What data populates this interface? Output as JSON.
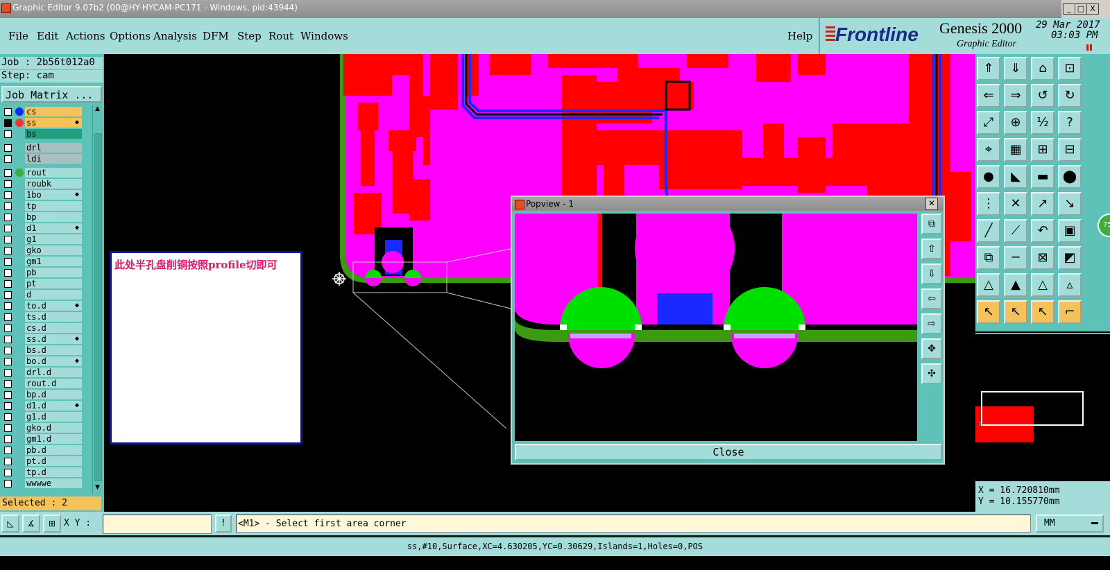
{
  "window": {
    "title": "Graphic Editor 9.07b2 (00@HY-HYCAM-PC171 - Windows, pid:43944)",
    "controls": [
      "_",
      "□",
      "X"
    ]
  },
  "menu": {
    "items": [
      "File",
      "Edit",
      "Actions",
      "Options",
      "Analysis",
      "DFM",
      "Step",
      "Rout",
      "Windows"
    ],
    "help": "Help"
  },
  "brand": {
    "logo": "Frontline",
    "product": "Genesis 2000",
    "subtitle": "Graphic Editor",
    "date": "29 Mar 2017",
    "time": "03:03 PM"
  },
  "job": {
    "job_label": "Job : 2b56t012a0",
    "step_label": "Step: cam",
    "matrix_button": "Job Matrix ..."
  },
  "layers": [
    {
      "name": "cs",
      "color": "#f5c25a",
      "dot": "#0030ff",
      "checked": false,
      "flag": ""
    },
    {
      "name": "ss",
      "color": "#f5c25a",
      "dot": "#ff3030",
      "checked": true,
      "flag": "w"
    },
    {
      "name": "bs",
      "color": "#21a080",
      "dot": "",
      "checked": false,
      "flag": ""
    },
    {
      "name": "drl",
      "color": "#a8c0c0",
      "dot": "",
      "checked": false,
      "flag": ""
    },
    {
      "name": "ldi",
      "color": "#a8c0c0",
      "dot": "",
      "checked": false,
      "flag": ""
    },
    {
      "name": "rout",
      "color": "#a3dcd8",
      "dot": "#3ab03a",
      "checked": false,
      "flag": ""
    },
    {
      "name": "roubk",
      "color": "#a3dcd8",
      "dot": "",
      "checked": false,
      "flag": ""
    },
    {
      "name": "1bo",
      "color": "#a3dcd8",
      "dot": "",
      "checked": false,
      "flag": "w"
    },
    {
      "name": "tp",
      "color": "#a3dcd8",
      "dot": "",
      "checked": false,
      "flag": ""
    },
    {
      "name": "bp",
      "color": "#a3dcd8",
      "dot": "",
      "checked": false,
      "flag": ""
    },
    {
      "name": "d1",
      "color": "#a3dcd8",
      "dot": "",
      "checked": false,
      "flag": "w"
    },
    {
      "name": "g1",
      "color": "#a3dcd8",
      "dot": "",
      "checked": false,
      "flag": ""
    },
    {
      "name": "gko",
      "color": "#a3dcd8",
      "dot": "",
      "checked": false,
      "flag": ""
    },
    {
      "name": "gm1",
      "color": "#a3dcd8",
      "dot": "",
      "checked": false,
      "flag": ""
    },
    {
      "name": "pb",
      "color": "#a3dcd8",
      "dot": "",
      "checked": false,
      "flag": ""
    },
    {
      "name": "pt",
      "color": "#a3dcd8",
      "dot": "",
      "checked": false,
      "flag": ""
    },
    {
      "name": "d",
      "color": "#a3dcd8",
      "dot": "",
      "checked": false,
      "flag": ""
    },
    {
      "name": "to.d",
      "color": "#a3dcd8",
      "dot": "",
      "checked": false,
      "flag": "w"
    },
    {
      "name": "ts.d",
      "color": "#a3dcd8",
      "dot": "",
      "checked": false,
      "flag": ""
    },
    {
      "name": "cs.d",
      "color": "#a3dcd8",
      "dot": "",
      "checked": false,
      "flag": ""
    },
    {
      "name": "ss.d",
      "color": "#a3dcd8",
      "dot": "",
      "checked": false,
      "flag": "w"
    },
    {
      "name": "bs.d",
      "color": "#a3dcd8",
      "dot": "",
      "checked": false,
      "flag": ""
    },
    {
      "name": "bo.d",
      "color": "#a3dcd8",
      "dot": "",
      "checked": false,
      "flag": "w"
    },
    {
      "name": "drl.d",
      "color": "#a3dcd8",
      "dot": "",
      "checked": false,
      "flag": ""
    },
    {
      "name": "rout.d",
      "color": "#a3dcd8",
      "dot": "",
      "checked": false,
      "flag": ""
    },
    {
      "name": "bp.d",
      "color": "#a3dcd8",
      "dot": "",
      "checked": false,
      "flag": ""
    },
    {
      "name": "d1.d",
      "color": "#a3dcd8",
      "dot": "",
      "checked": false,
      "flag": "w"
    },
    {
      "name": "g1.d",
      "color": "#a3dcd8",
      "dot": "",
      "checked": false,
      "flag": ""
    },
    {
      "name": "gko.d",
      "color": "#a3dcd8",
      "dot": "",
      "checked": false,
      "flag": ""
    },
    {
      "name": "gm1.d",
      "color": "#a3dcd8",
      "dot": "",
      "checked": false,
      "flag": ""
    },
    {
      "name": "pb.d",
      "color": "#a3dcd8",
      "dot": "",
      "checked": false,
      "flag": ""
    },
    {
      "name": "pt.d",
      "color": "#a3dcd8",
      "dot": "",
      "checked": false,
      "flag": ""
    },
    {
      "name": "tp.d",
      "color": "#a3dcd8",
      "dot": "",
      "checked": false,
      "flag": ""
    },
    {
      "name": "wwwwe",
      "color": "#a3dcd8",
      "dot": "",
      "checked": false,
      "flag": ""
    }
  ],
  "selected_label": "Selected : 2",
  "note_text": "此处半孔盘削铜按照profile切即可",
  "popview": {
    "title": "Popview - 1",
    "close_button": "Close"
  },
  "coords": {
    "x": "X = 16.720810mm",
    "y": "Y = 10.155770mm"
  },
  "command": {
    "xy_label": "X Y :",
    "prompt": "<M1> - Select first area corner",
    "units": "MM"
  },
  "status": "ss,#10,Surface,XC=4.630205,YC=0.30629,Islands=1,Holes=0,POS",
  "badge": "75",
  "colors": {
    "copper": "#ff00ff",
    "solder": "#ff0000",
    "trace": "#1a2aff",
    "pad": "#00e000",
    "panel": "#5fc2b8",
    "button": "#a3dcd8",
    "highlight": "#f5c25a"
  }
}
